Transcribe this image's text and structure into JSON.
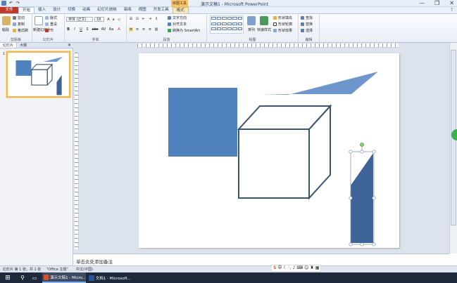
{
  "window": {
    "title": "演示文稿1 - Microsoft PowerPoint",
    "context_tab_group": "绘图工具",
    "controls": [
      "—",
      "❐",
      "✕"
    ]
  },
  "qat": [
    "save-icon",
    "undo-icon",
    "redo-icon"
  ],
  "tabs": [
    "文件",
    "开始",
    "插入",
    "设计",
    "切换",
    "动画",
    "幻灯片放映",
    "审阅",
    "视图",
    "开发工具",
    "格式"
  ],
  "active_tab": "开始",
  "ribbon": {
    "clipboard": {
      "label": "剪贴板",
      "paste": "粘贴",
      "cut": "剪切",
      "copy": "复制",
      "format_painter": "格式刷"
    },
    "slides": {
      "label": "幻灯片",
      "new_slide": "新建幻灯片",
      "layout": "版式",
      "reset": "重设",
      "section": "节"
    },
    "font": {
      "label": "字体",
      "name": "宋体 (正文)",
      "size": "18",
      "buttons": [
        "B",
        "I",
        "U",
        "S",
        "abc",
        "AV",
        "Aa",
        "A"
      ]
    },
    "paragraph": {
      "label": "段落",
      "text_direction": "文字方向",
      "align_text": "对齐文本",
      "smartart": "转换为 SmartArt"
    },
    "drawing": {
      "label": "绘图",
      "arrange": "排列",
      "quick_styles": "快速样式",
      "fill": "形状填充",
      "outline": "形状轮廓",
      "effects": "形状效果"
    },
    "editing": {
      "label": "编辑",
      "find": "查找",
      "replace": "替换",
      "select": "选择"
    }
  },
  "panel": {
    "tab_slides": "幻灯片",
    "tab_outline": "大纲",
    "thumb_number": "1"
  },
  "notes_placeholder": "单击此处添加备注",
  "status": {
    "slide_info": "幻灯片 第 1 张，共 1 张",
    "theme": "\"Office 主题\"",
    "language": "中文(中国)"
  },
  "ime_icons": [
    "sogou-icon",
    "中",
    "moon-icon",
    "punct-icon",
    "mic-icon",
    "keyboard-icon",
    "user-icon",
    "shirt-icon",
    "grid-icon"
  ],
  "taskbar": {
    "items": [
      {
        "label": "演示文稿1 - Micro...",
        "icon": "powerpoint-icon"
      },
      {
        "label": "文档1 - Microsoft...",
        "icon": "word-icon"
      }
    ]
  },
  "colors": {
    "shape_fill": "#4f81bd",
    "shape_dark": "#3e6399",
    "outline": "#3b556e",
    "accent": "#c0392b"
  }
}
